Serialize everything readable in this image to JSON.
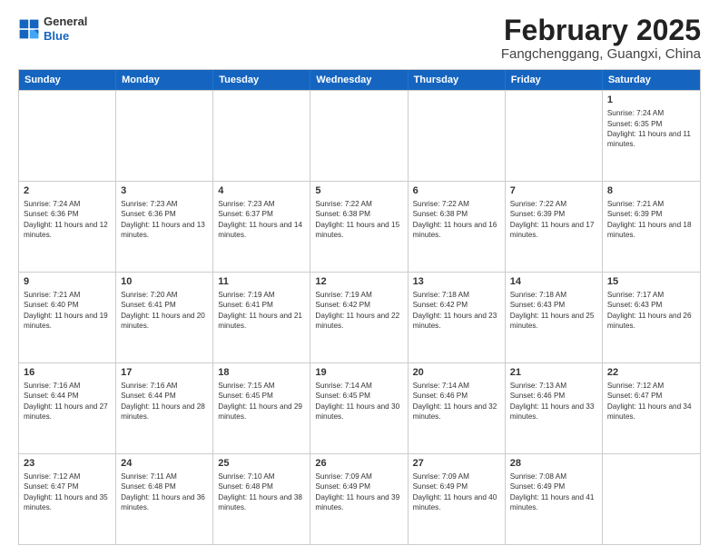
{
  "header": {
    "logo_general": "General",
    "logo_blue": "Blue",
    "month_title": "February 2025",
    "subtitle": "Fangchenggang, Guangxi, China"
  },
  "days_of_week": [
    "Sunday",
    "Monday",
    "Tuesday",
    "Wednesday",
    "Thursday",
    "Friday",
    "Saturday"
  ],
  "weeks": [
    [
      {
        "day": "",
        "text": ""
      },
      {
        "day": "",
        "text": ""
      },
      {
        "day": "",
        "text": ""
      },
      {
        "day": "",
        "text": ""
      },
      {
        "day": "",
        "text": ""
      },
      {
        "day": "",
        "text": ""
      },
      {
        "day": "1",
        "text": "Sunrise: 7:24 AM\nSunset: 6:35 PM\nDaylight: 11 hours and 11 minutes."
      }
    ],
    [
      {
        "day": "2",
        "text": "Sunrise: 7:24 AM\nSunset: 6:36 PM\nDaylight: 11 hours and 12 minutes."
      },
      {
        "day": "3",
        "text": "Sunrise: 7:23 AM\nSunset: 6:36 PM\nDaylight: 11 hours and 13 minutes."
      },
      {
        "day": "4",
        "text": "Sunrise: 7:23 AM\nSunset: 6:37 PM\nDaylight: 11 hours and 14 minutes."
      },
      {
        "day": "5",
        "text": "Sunrise: 7:22 AM\nSunset: 6:38 PM\nDaylight: 11 hours and 15 minutes."
      },
      {
        "day": "6",
        "text": "Sunrise: 7:22 AM\nSunset: 6:38 PM\nDaylight: 11 hours and 16 minutes."
      },
      {
        "day": "7",
        "text": "Sunrise: 7:22 AM\nSunset: 6:39 PM\nDaylight: 11 hours and 17 minutes."
      },
      {
        "day": "8",
        "text": "Sunrise: 7:21 AM\nSunset: 6:39 PM\nDaylight: 11 hours and 18 minutes."
      }
    ],
    [
      {
        "day": "9",
        "text": "Sunrise: 7:21 AM\nSunset: 6:40 PM\nDaylight: 11 hours and 19 minutes."
      },
      {
        "day": "10",
        "text": "Sunrise: 7:20 AM\nSunset: 6:41 PM\nDaylight: 11 hours and 20 minutes."
      },
      {
        "day": "11",
        "text": "Sunrise: 7:19 AM\nSunset: 6:41 PM\nDaylight: 11 hours and 21 minutes."
      },
      {
        "day": "12",
        "text": "Sunrise: 7:19 AM\nSunset: 6:42 PM\nDaylight: 11 hours and 22 minutes."
      },
      {
        "day": "13",
        "text": "Sunrise: 7:18 AM\nSunset: 6:42 PM\nDaylight: 11 hours and 23 minutes."
      },
      {
        "day": "14",
        "text": "Sunrise: 7:18 AM\nSunset: 6:43 PM\nDaylight: 11 hours and 25 minutes."
      },
      {
        "day": "15",
        "text": "Sunrise: 7:17 AM\nSunset: 6:43 PM\nDaylight: 11 hours and 26 minutes."
      }
    ],
    [
      {
        "day": "16",
        "text": "Sunrise: 7:16 AM\nSunset: 6:44 PM\nDaylight: 11 hours and 27 minutes."
      },
      {
        "day": "17",
        "text": "Sunrise: 7:16 AM\nSunset: 6:44 PM\nDaylight: 11 hours and 28 minutes."
      },
      {
        "day": "18",
        "text": "Sunrise: 7:15 AM\nSunset: 6:45 PM\nDaylight: 11 hours and 29 minutes."
      },
      {
        "day": "19",
        "text": "Sunrise: 7:14 AM\nSunset: 6:45 PM\nDaylight: 11 hours and 30 minutes."
      },
      {
        "day": "20",
        "text": "Sunrise: 7:14 AM\nSunset: 6:46 PM\nDaylight: 11 hours and 32 minutes."
      },
      {
        "day": "21",
        "text": "Sunrise: 7:13 AM\nSunset: 6:46 PM\nDaylight: 11 hours and 33 minutes."
      },
      {
        "day": "22",
        "text": "Sunrise: 7:12 AM\nSunset: 6:47 PM\nDaylight: 11 hours and 34 minutes."
      }
    ],
    [
      {
        "day": "23",
        "text": "Sunrise: 7:12 AM\nSunset: 6:47 PM\nDaylight: 11 hours and 35 minutes."
      },
      {
        "day": "24",
        "text": "Sunrise: 7:11 AM\nSunset: 6:48 PM\nDaylight: 11 hours and 36 minutes."
      },
      {
        "day": "25",
        "text": "Sunrise: 7:10 AM\nSunset: 6:48 PM\nDaylight: 11 hours and 38 minutes."
      },
      {
        "day": "26",
        "text": "Sunrise: 7:09 AM\nSunset: 6:49 PM\nDaylight: 11 hours and 39 minutes."
      },
      {
        "day": "27",
        "text": "Sunrise: 7:09 AM\nSunset: 6:49 PM\nDaylight: 11 hours and 40 minutes."
      },
      {
        "day": "28",
        "text": "Sunrise: 7:08 AM\nSunset: 6:49 PM\nDaylight: 11 hours and 41 minutes."
      },
      {
        "day": "",
        "text": ""
      }
    ]
  ]
}
